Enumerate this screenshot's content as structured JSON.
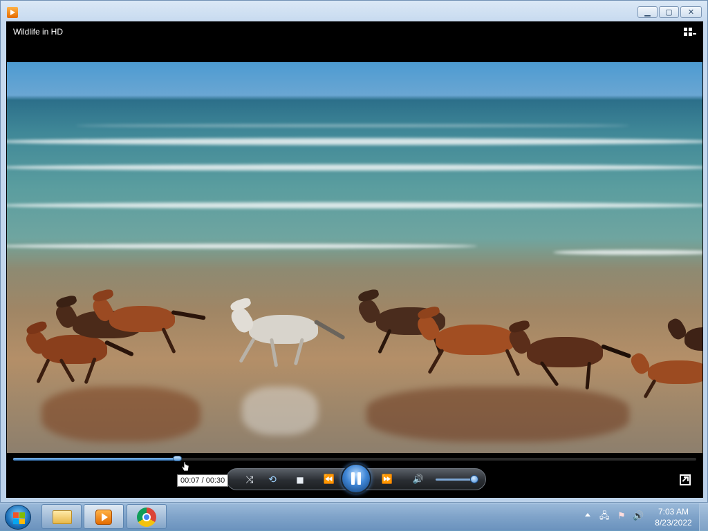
{
  "window": {
    "title": "Wildlife in HD",
    "caption_buttons": {
      "minimize": "▁",
      "maximize": "▢",
      "close": "✕"
    }
  },
  "player": {
    "time_tooltip": "00:07 / 00:30",
    "progress": 0.24,
    "volume": 0.9,
    "icons": {
      "shuffle": "⤨",
      "repeat": "⟲",
      "stop": "■",
      "previous": "⏪",
      "next": "⏩",
      "volume": "🔊"
    }
  },
  "taskbar": {
    "apps": [
      "windows-explorer",
      "windows-media-player",
      "google-chrome"
    ],
    "tray_icons": {
      "network": "🖧",
      "action-center": "⚑",
      "volume": "🔊"
    },
    "clock_time": "7:03 AM",
    "clock_date": "8/23/2022"
  },
  "colors": {
    "accent": "#3f86d6",
    "taskbar": "#7fa3c9",
    "window_frame": "#c7daef"
  }
}
